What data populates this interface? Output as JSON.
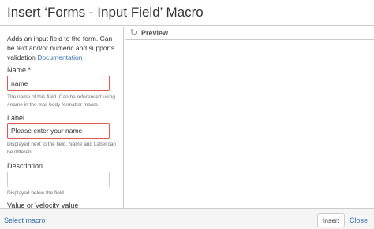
{
  "dialog": {
    "title": "Insert ‘Forms - Input Field’ Macro"
  },
  "left": {
    "intro_text": "Adds an input field to the form. Can be text and/or numeric and supports validation",
    "intro_link": "Documentation",
    "name": {
      "label": "Name *",
      "value": "name",
      "help": "The name of this field. Can be referenced using #name in the mail body formatter macro"
    },
    "label_field": {
      "label": "Label",
      "value": "Please enter your name",
      "help": "Displayed next to the field. Name and Label can be different"
    },
    "description": {
      "label": "Description",
      "value": "",
      "help": "Displayed below the field"
    },
    "value_field": {
      "label": "Value or Velocity value"
    }
  },
  "preview": {
    "label": "Preview",
    "icon": "refresh-icon"
  },
  "footer": {
    "select_macro": "Select macro",
    "insert_label": "Insert",
    "close_label": "Close"
  },
  "colors": {
    "link": "#3572b0",
    "highlight_border": "#e05a4f",
    "border": "#cccccc"
  }
}
